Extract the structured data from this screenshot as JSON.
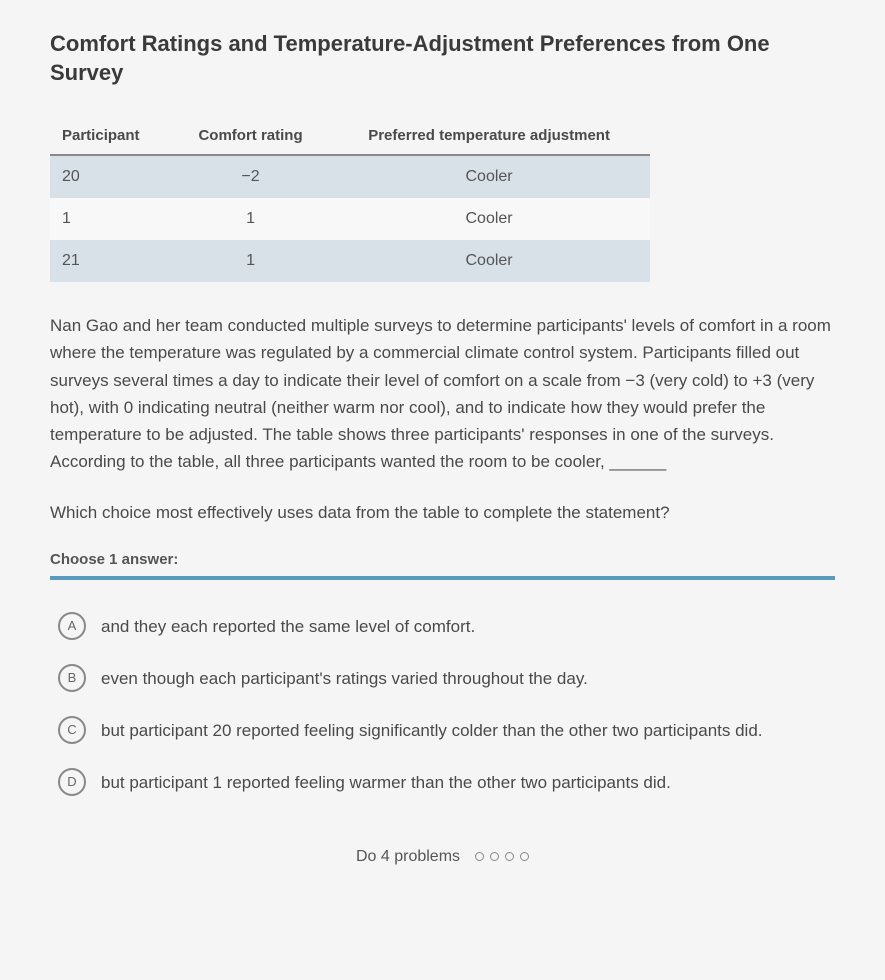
{
  "title": "Comfort Ratings and Temperature-Adjustment Preferences from One Survey",
  "table": {
    "headers": [
      "Participant",
      "Comfort rating",
      "Preferred temperature adjustment"
    ],
    "rows": [
      {
        "participant": "20",
        "rating": "−2",
        "adjustment": "Cooler"
      },
      {
        "participant": "1",
        "rating": "1",
        "adjustment": "Cooler"
      },
      {
        "participant": "21",
        "rating": "1",
        "adjustment": "Cooler"
      }
    ]
  },
  "passage": "Nan Gao and her team conducted multiple surveys to determine participants' levels of comfort in a room where the temperature was regulated by a commercial climate control system. Participants filled out surveys several times a day to indicate their level of comfort on a scale from −3 (very cold) to +3 (very hot), with 0 indicating neutral (neither warm nor cool), and to indicate how they would prefer the temperature to be adjusted. The table shows three participants' responses in one of the surveys. According to the table, all three participants wanted the room to be cooler, ______",
  "question": "Which choice most effectively uses data from the table to complete the statement?",
  "instruction": "Choose 1 answer:",
  "choices": [
    {
      "letter": "A",
      "text": "and they each reported the same level of comfort."
    },
    {
      "letter": "B",
      "text": "even though each participant's ratings varied throughout the day."
    },
    {
      "letter": "C",
      "text": "but participant 20 reported feeling significantly colder than the other two participants did."
    },
    {
      "letter": "D",
      "text": "but participant 1 reported feeling warmer than the other two participants did."
    }
  ],
  "footer": {
    "text": "Do 4 problems"
  }
}
